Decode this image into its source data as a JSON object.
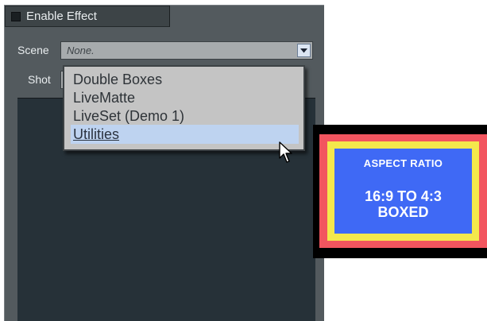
{
  "panel": {
    "enable_effect": {
      "label": "Enable Effect",
      "checked": false
    },
    "scene": {
      "label": "Scene",
      "value": "None."
    },
    "shot": {
      "label": "Shot"
    }
  },
  "dropdown": {
    "items": [
      {
        "label": "Double Boxes",
        "selected": false
      },
      {
        "label": "LiveMatte",
        "selected": false
      },
      {
        "label": "LiveSet (Demo 1)",
        "selected": false
      },
      {
        "label": "Utilities",
        "selected": true
      }
    ]
  },
  "thumbnail": {
    "line1": "ASPECT RATIO",
    "line2": "16:9 TO 4:3",
    "line3": "BOXED"
  },
  "icons": {
    "dropdown_arrow": "chevron-down-icon",
    "cursor": "mouse-pointer-icon"
  },
  "colors": {
    "panel_bg": "#535a5e",
    "preview_bg": "#263138",
    "dropdown_bg": "#c4c4c4",
    "selection_highlight": "#bed3f0",
    "thumb_red": "#f2555f",
    "thumb_yellow": "#f4e84c",
    "thumb_blue": "#3f69f5"
  }
}
